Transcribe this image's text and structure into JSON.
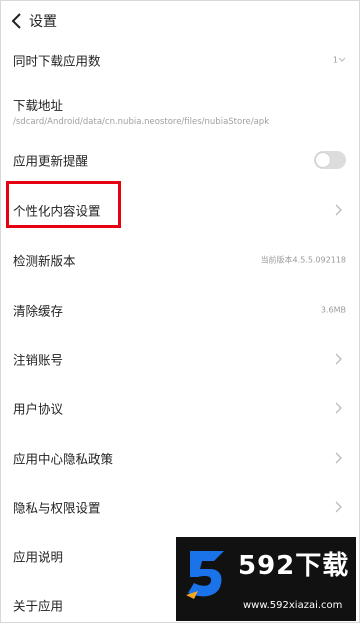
{
  "header": {
    "title": "设置"
  },
  "rows": [
    {
      "label": "同时下载应用数",
      "value": "1"
    },
    {
      "label": "下载地址",
      "sub": "/sdcard/Android/data/cn.nubia.neostore/files/nubiaStore/apk"
    },
    {
      "label": "应用更新提醒",
      "toggle": false
    },
    {
      "label": "个性化内容设置"
    },
    {
      "label": "检测新版本",
      "value": "当前版本4.5.5.092118"
    },
    {
      "label": "清除缓存",
      "value": "3.6MB"
    },
    {
      "label": "注销账号"
    },
    {
      "label": "用户协议"
    },
    {
      "label": "应用中心隐私政策"
    },
    {
      "label": "隐私与权限设置"
    },
    {
      "label": "应用说明"
    },
    {
      "label": "关于应用"
    }
  ],
  "annotation": {
    "color": "#e60012"
  },
  "watermark": {
    "brand": "592下载",
    "url": "www.592xiazai.com"
  }
}
